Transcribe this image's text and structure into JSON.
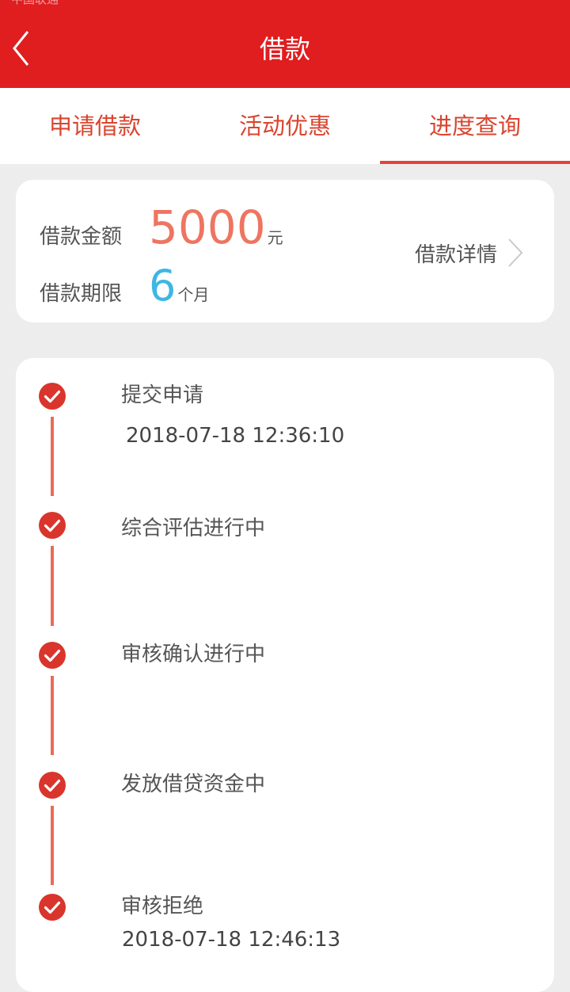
{
  "status_bar": {
    "carrier": "中国联通"
  },
  "header": {
    "title": "借款"
  },
  "tabs": [
    {
      "label": "申请借款",
      "active": false
    },
    {
      "label": "活动优惠",
      "active": false
    },
    {
      "label": "进度查询",
      "active": true
    }
  ],
  "summary": {
    "amount_label": "借款金额",
    "amount_value": "5000",
    "amount_unit": "元",
    "term_label": "借款期限",
    "term_value": "6",
    "term_unit": "个月",
    "detail_label": "借款详情"
  },
  "progress": {
    "steps": [
      {
        "title": "提交申请",
        "time": "2018-07-18 12:36:10"
      },
      {
        "title": "综合评估进行中",
        "time": ""
      },
      {
        "title": "审核确认进行中",
        "time": ""
      },
      {
        "title": "发放借贷资金中",
        "time": ""
      },
      {
        "title": "审核拒绝",
        "time": "2018-07-18 12:46:13"
      }
    ]
  },
  "colors": {
    "header_bg": "#e01d1f",
    "accent": "#d9452f",
    "amount": "#ee7561",
    "term": "#3eb6e6",
    "timeline": "#ec6a55"
  }
}
